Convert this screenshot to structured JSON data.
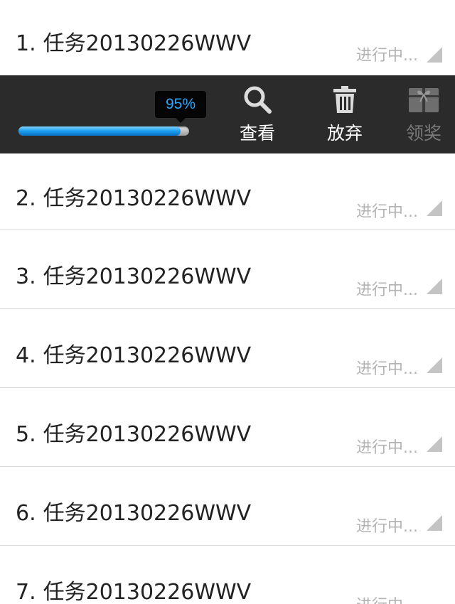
{
  "tasks": [
    {
      "number": "1.",
      "title": "任务20130226WWV",
      "status": "进行中..."
    },
    {
      "number": "2.",
      "title": "任务20130226WWV",
      "status": "进行中..."
    },
    {
      "number": "3.",
      "title": "任务20130226WWV",
      "status": "进行中..."
    },
    {
      "number": "4.",
      "title": "任务20130226WWV",
      "status": "进行中..."
    },
    {
      "number": "5.",
      "title": "任务20130226WWV",
      "status": "进行中..."
    },
    {
      "number": "6.",
      "title": "任务20130226WWV",
      "status": "进行中..."
    },
    {
      "number": "7.",
      "title": "任务20130226WWV",
      "status": "进行中..."
    }
  ],
  "action_bar": {
    "progress_label": "95%",
    "progress_value": 0.95,
    "view_label": "查看",
    "abandon_label": "放弃",
    "claim_label": "领奖",
    "claim_enabled": false,
    "view_icon": "search-icon",
    "abandon_icon": "trash-icon",
    "claim_icon": "gift-icon"
  },
  "colors": {
    "bar_background": "#2b2b2b",
    "progress_blue": "#1a9ef0",
    "status_gray": "#b3b3b3"
  }
}
